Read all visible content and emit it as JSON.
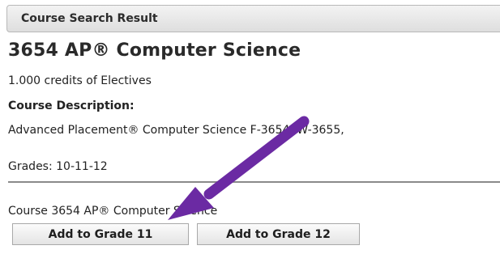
{
  "panel": {
    "header_label": "Course Search Result"
  },
  "course": {
    "title": "3654 AP® Computer Science",
    "credits": "1.000 credits of Electives",
    "description_heading": "Course Description:",
    "description_text": "Advanced Placement® Computer Science F-3654, W-3655,",
    "grades": "Grades: 10-11-12",
    "summary_line": "Course 3654 AP® Computer Science"
  },
  "actions": {
    "add_grade_11_label": "Add to Grade 11",
    "add_grade_12_label": "Add to Grade 12"
  },
  "annotation": {
    "arrow_color": "#6b2aa3"
  }
}
